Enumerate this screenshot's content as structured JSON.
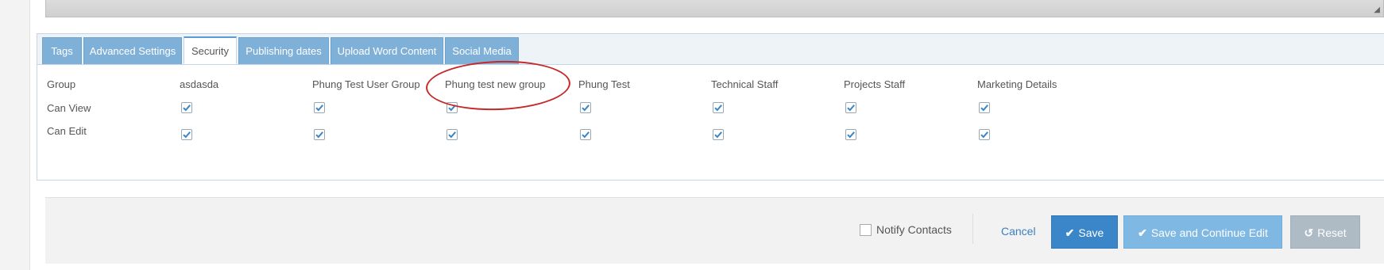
{
  "tabs": [
    {
      "label": "Tags",
      "active": false
    },
    {
      "label": "Advanced Settings",
      "active": false
    },
    {
      "label": "Security",
      "active": true
    },
    {
      "label": "Publishing dates",
      "active": false
    },
    {
      "label": "Upload Word Content",
      "active": false
    },
    {
      "label": "Social Media",
      "active": false
    }
  ],
  "security": {
    "group_header": "Group",
    "can_view_label": "Can View",
    "can_edit_label": "Can Edit",
    "groups": [
      {
        "name": "asdasda",
        "can_view": true,
        "can_edit": true
      },
      {
        "name": "Phung Test User Group",
        "can_view": true,
        "can_edit": true
      },
      {
        "name": "Phung test new group",
        "can_view": true,
        "can_edit": true,
        "highlighted": true
      },
      {
        "name": "Phung Test",
        "can_view": true,
        "can_edit": true
      },
      {
        "name": "Technical Staff",
        "can_view": true,
        "can_edit": true
      },
      {
        "name": "Projects Staff",
        "can_view": true,
        "can_edit": true
      },
      {
        "name": "Marketing Details",
        "can_view": true,
        "can_edit": true
      }
    ]
  },
  "actions": {
    "notify_label": "Notify Contacts",
    "notify_checked": false,
    "cancel_label": "Cancel",
    "save_label": "Save",
    "save_continue_label": "Save and Continue Edit",
    "reset_label": "Reset"
  },
  "colors": {
    "tab_inactive": "#7fb0d8",
    "save_button": "#3a86c8",
    "save_continue_button": "#7fb8e2",
    "reset_button": "#aebbc4",
    "highlight_ellipse": "#c62828",
    "checkmark": "#3a86c8"
  },
  "icons": {
    "resize_grip": "resize-grip-icon",
    "save": "check-icon",
    "reset": "undo-icon"
  }
}
